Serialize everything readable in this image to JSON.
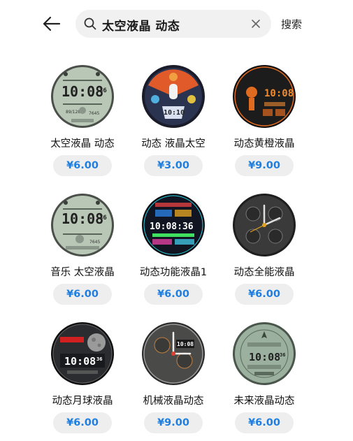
{
  "header": {
    "back_icon": "arrow-left-icon",
    "search_icon": "search-icon",
    "search_query": "太空液晶 动态",
    "clear_icon": "close-icon",
    "search_button_label": "搜索"
  },
  "faces": [
    {
      "name": "太空液晶 动态",
      "price": "¥6.00",
      "time": "10:08",
      "sec": "36",
      "style": "lcd-green"
    },
    {
      "name": "动态 液晶太空",
      "price": "¥3.00",
      "time": "10:10",
      "sec": "",
      "style": "space-color"
    },
    {
      "name": "动态黄橙液晶",
      "price": "¥9.00",
      "time": "10:08",
      "sec": "",
      "style": "orange-dark"
    },
    {
      "name": "音乐 太空液晶",
      "price": "¥6.00",
      "time": "10:08",
      "sec": "36",
      "style": "lcd-green-music"
    },
    {
      "name": "动态功能液晶1",
      "price": "¥6.00",
      "time": "10:08:36",
      "sec": "",
      "style": "neon-dark"
    },
    {
      "name": "动态全能液晶",
      "price": "¥6.00",
      "time": "",
      "sec": "",
      "style": "analog-dark"
    },
    {
      "name": "动态月球液晶",
      "price": "¥6.00",
      "time": "10:08",
      "sec": "36",
      "style": "moon-dark"
    },
    {
      "name": "机械液晶动态",
      "price": "¥9.00",
      "time": "10:08",
      "sec": "",
      "style": "mech"
    },
    {
      "name": "未来液晶动态",
      "price": "¥6.00",
      "time": "10:08",
      "sec": "36",
      "style": "future-green"
    }
  ]
}
